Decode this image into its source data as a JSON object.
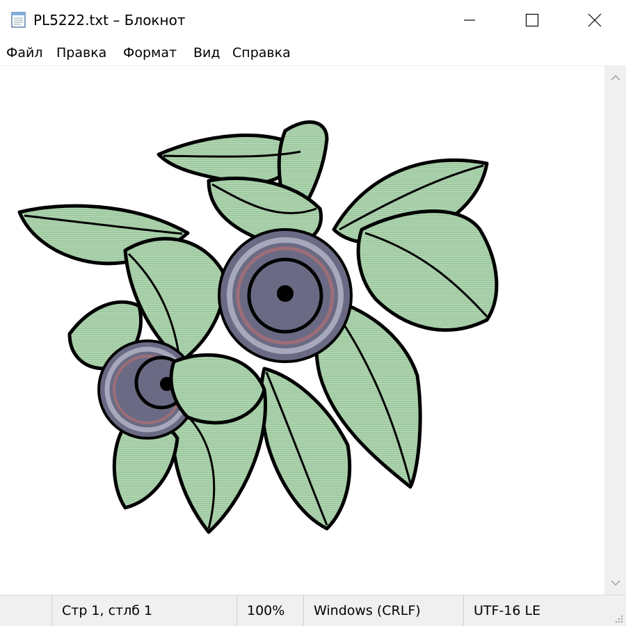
{
  "window": {
    "title": "PL5222.txt – Блокнот",
    "app_icon": "notepad-icon",
    "controls": [
      "minimize-icon",
      "maximize-icon",
      "close-icon"
    ]
  },
  "menu": {
    "items": [
      "Файл",
      "Правка",
      "Формат",
      "Вид",
      "Справка"
    ]
  },
  "editor": {
    "content_image": "blueberry-leaves-illustration",
    "colors": {
      "leaf": "#9ec8a0",
      "outline": "#000000",
      "berry": "#6b6a84",
      "berry_ring": "#a8a8bc",
      "berry_accent": "#9c6e78"
    }
  },
  "scrollbar": {
    "up": "chevron-up-icon",
    "down": "chevron-down-icon"
  },
  "status": {
    "position": "Стр 1, стлб 1",
    "zoom": "100%",
    "line_ending": "Windows (CRLF)",
    "encoding": "UTF-16 LE"
  }
}
